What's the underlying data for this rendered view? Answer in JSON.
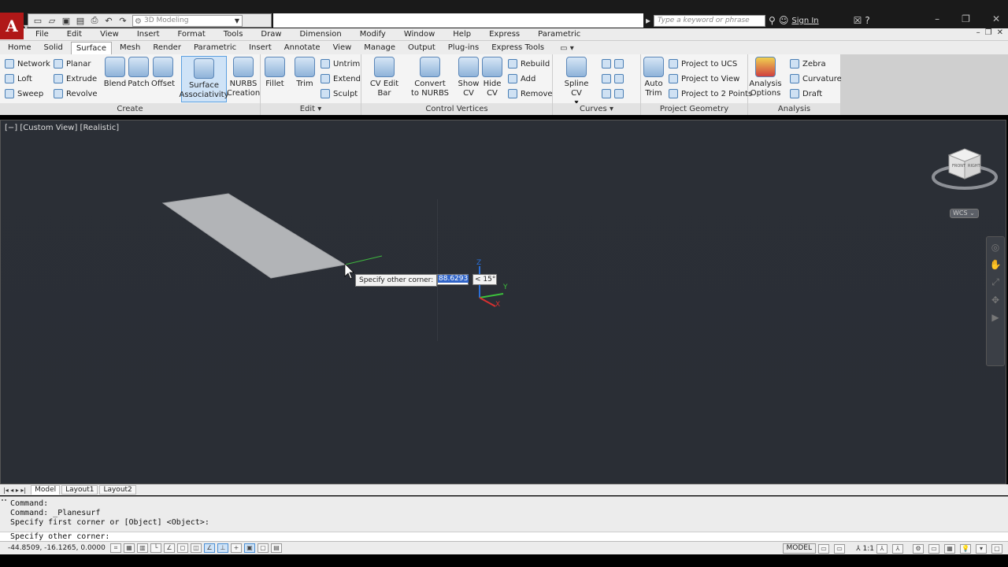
{
  "titlebar": {
    "workspace": "3D Modeling",
    "search_placeholder": "Type a keyword or phrase",
    "sign_in": "Sign In",
    "help": "?",
    "qat_icons": [
      "new-icon",
      "open-icon",
      "save-icon",
      "saveas-icon",
      "print-icon",
      "undo-icon",
      "redo-icon"
    ]
  },
  "menus": [
    "File",
    "Edit",
    "View",
    "Insert",
    "Format",
    "Tools",
    "Draw",
    "Dimension",
    "Modify",
    "Window",
    "Help",
    "Express",
    "Parametric"
  ],
  "ribbon_tabs": [
    "Home",
    "Solid",
    "Surface",
    "Mesh",
    "Render",
    "Parametric",
    "Insert",
    "Annotate",
    "View",
    "Manage",
    "Output",
    "Plug-ins",
    "Express Tools"
  ],
  "active_tab": "Surface",
  "ribbon": {
    "create": {
      "title": "Create",
      "small": [
        "Network",
        "Loft",
        "Sweep",
        "Planar",
        "Extrude",
        "Revolve"
      ],
      "big": [
        "Blend",
        "Patch",
        "Offset",
        "Surface Associativity",
        "NURBS Creation"
      ]
    },
    "edit": {
      "title": "Edit",
      "big": [
        "Fillet",
        "Trim"
      ],
      "small": [
        "Untrim",
        "Extend",
        "Sculpt"
      ]
    },
    "control_vertices": {
      "title": "Control Vertices",
      "big": [
        "CV Edit Bar",
        "Convert to NURBS",
        "Show CV",
        "Hide CV"
      ],
      "small": [
        "Rebuild",
        "Add",
        "Remove"
      ]
    },
    "curves": {
      "title": "Curves",
      "big": [
        "Spline CV"
      ]
    },
    "project_geometry": {
      "title": "Project Geometry",
      "big": [
        "Auto Trim"
      ],
      "small": [
        "Project to UCS",
        "Project to View",
        "Project to 2 Points"
      ]
    },
    "analysis": {
      "title": "Analysis",
      "big": [
        "Analysis Options"
      ],
      "small": [
        "Zebra",
        "Curvature",
        "Draft"
      ]
    }
  },
  "viewport": {
    "label": "[−] [Custom View] [Realistic]",
    "prompt": "Specify other corner:",
    "dyn_value": "88.6293",
    "angle": "< 15°",
    "wcs": "WCS ⌄",
    "cube_faces": [
      "FRONT",
      "RIGHT"
    ]
  },
  "layout_tabs": [
    "Model",
    "Layout1",
    "Layout2"
  ],
  "command": {
    "lines": [
      "Command:",
      "Command:  _Planesurf",
      "Specify first corner or [Object] <Object>:"
    ],
    "current": "Specify other corner:"
  },
  "status": {
    "coords": "-44.8509, -16.1265, 0.0000",
    "model": "MODEL",
    "scale": "1:1"
  }
}
